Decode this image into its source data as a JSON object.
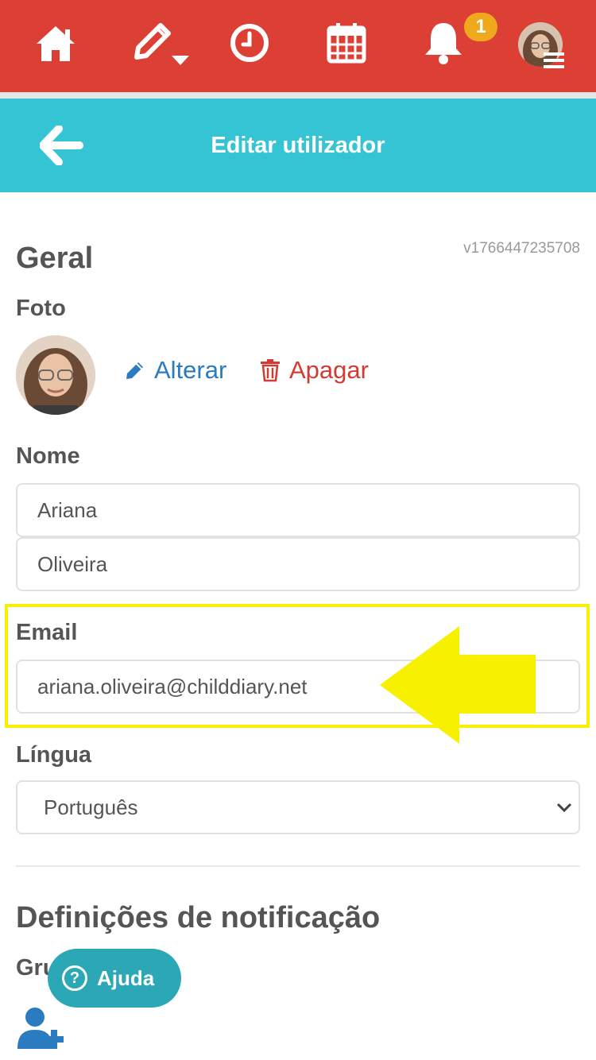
{
  "nav": {
    "home_icon": "home-icon",
    "edit_icon": "pencil-dropdown-icon",
    "clock_icon": "clock-icon",
    "calendar_icon": "calendar-icon",
    "bell_icon": "bell-icon",
    "notification_count": "1",
    "menu_icon": "hamburger-icon"
  },
  "header": {
    "title": "Editar utilizador",
    "back_icon": "arrow-left-icon"
  },
  "version": "v1766447235708",
  "general": {
    "heading": "Geral",
    "photo_label": "Foto",
    "change_label": "Alterar",
    "delete_label": "Apagar"
  },
  "name": {
    "label": "Nome",
    "first_name": "Ariana",
    "last_name": "Oliveira"
  },
  "email": {
    "label": "Email",
    "value": "ariana.oliveira@childdiary.net"
  },
  "language": {
    "label": "Língua",
    "selected": "Português"
  },
  "notifications": {
    "heading": "Definições de notificação",
    "groups_label": "Grupos"
  },
  "help": {
    "label": "Ajuda"
  },
  "colors": {
    "topbar": "#dc3f33",
    "header": "#35c4d4",
    "link_blue": "#2a7bbf",
    "delete_red": "#d33b32",
    "highlight": "#f7f100",
    "badge": "#f0a81c",
    "help": "#2ba7b6"
  }
}
